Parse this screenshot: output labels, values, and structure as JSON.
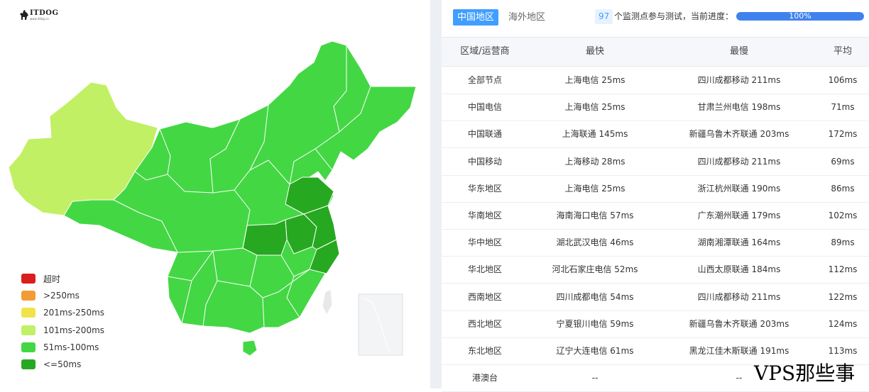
{
  "logo": {
    "name": "ITDOG",
    "subtitle": "www.itdog.cn"
  },
  "legend": [
    {
      "label": "超时",
      "color": "#d81e1e"
    },
    {
      "label": ">250ms",
      "color": "#f39c35"
    },
    {
      "label": "201ms-250ms",
      "color": "#f0e44a"
    },
    {
      "label": "101ms-200ms",
      "color": "#c1f064"
    },
    {
      "label": "51ms-100ms",
      "color": "#44d744"
    },
    {
      "label": "<=50ms",
      "color": "#27a821"
    }
  ],
  "tabs": {
    "domestic": "中国地区",
    "overseas": "海外地区"
  },
  "progress": {
    "node_count": "97",
    "text": "个监测点参与测试，当前进度：",
    "percent": 100,
    "label": "100%"
  },
  "table": {
    "headers": [
      "区域/运营商",
      "最快",
      "最慢",
      "平均"
    ],
    "rows": [
      [
        "全部节点",
        "上海电信 25ms",
        "四川成都移动 211ms",
        "106ms"
      ],
      [
        "中国电信",
        "上海电信 25ms",
        "甘肃兰州电信 198ms",
        "71ms"
      ],
      [
        "中国联通",
        "上海联通 145ms",
        "新疆乌鲁木齐联通 203ms",
        "172ms"
      ],
      [
        "中国移动",
        "上海移动 28ms",
        "四川成都移动 211ms",
        "69ms"
      ],
      [
        "华东地区",
        "上海电信 25ms",
        "浙江杭州联通 190ms",
        "86ms"
      ],
      [
        "华南地区",
        "海南海口电信 57ms",
        "广东潮州联通 179ms",
        "102ms"
      ],
      [
        "华中地区",
        "湖北武汉电信 46ms",
        "湖南湘潭联通 164ms",
        "89ms"
      ],
      [
        "华北地区",
        "河北石家庄电信 52ms",
        "山西太原联通 184ms",
        "112ms"
      ],
      [
        "西南地区",
        "四川成都电信 54ms",
        "四川成都移动 211ms",
        "122ms"
      ],
      [
        "西北地区",
        "宁夏银川电信 59ms",
        "新疆乌鲁木齐联通 203ms",
        "124ms"
      ],
      [
        "东北地区",
        "辽宁大连电信 61ms",
        "黑龙江佳木斯联通 191ms",
        "113ms"
      ],
      [
        "港澳台",
        "--",
        "--",
        ""
      ]
    ]
  },
  "watermark": "VPS那些事"
}
